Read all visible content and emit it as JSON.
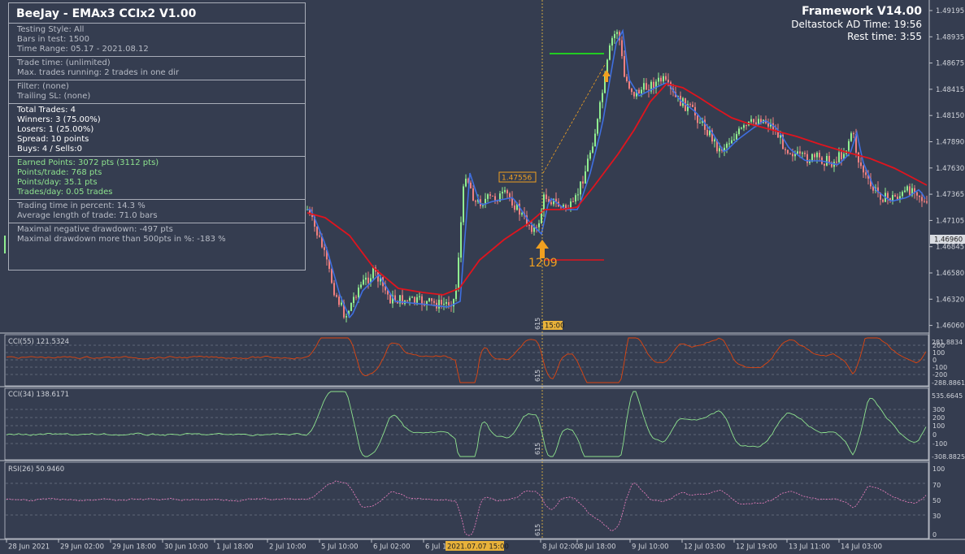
{
  "panel": {
    "title": "BeeJay - EMAx3 CCIx2 V1.00",
    "sections": [
      {
        "style": "gray",
        "lines": [
          "Testing Style:  All",
          "Bars in test: 1500",
          "Time Range: 05.17 - 2021.08.12"
        ]
      },
      {
        "style": "gray",
        "lines": [
          "Trade time: (unlimited)",
          "Max. trades running: 2 trades in one dir"
        ]
      },
      {
        "style": "gray",
        "lines": [
          "Filter: (none)",
          "Trailing SL: (none)"
        ]
      },
      {
        "style": "white",
        "lines": [
          "Total Trades: 4",
          "Winners: 3  (75.00%)",
          "Losers: 1  (25.00%)",
          "Spread: 10 points",
          "Buys: 4 / Sells:0"
        ]
      },
      {
        "style": "green",
        "lines": [
          "Earned Points: 3072 pts (3112 pts)",
          "Points/trade: 768 pts",
          "Points/day: 35.1 pts",
          "Trades/day: 0.05 trades"
        ]
      },
      {
        "style": "gray",
        "lines": [
          "Trading time in percent: 14.3 %",
          "Average length of trade: 71.0 bars"
        ]
      },
      {
        "style": "gray",
        "lines": [
          "Maximal negative drawdown: -497 pts",
          "Maximal drawdown more than 500pts in %: -183 %"
        ]
      }
    ]
  },
  "top_right": {
    "framework": "Framework V14.00",
    "time_line": "Deltastock AD Time: 19:56",
    "rest_line": "Rest time: 3:55"
  },
  "chart": {
    "price_ticks": [
      "1.49195",
      "1.48935",
      "1.48675",
      "1.48415",
      "1.48150",
      "1.47890",
      "1.47630",
      "1.47365",
      "1.47105",
      "1.46845",
      "1.46580",
      "1.46320",
      "1.46060"
    ],
    "current_price": "1.46960",
    "price_marker": "1.47556",
    "trade_label": "1209",
    "vline_label": "615",
    "vline_time": "15:00",
    "dates": [
      "28 Jun 2021",
      "29 Jun 02:00",
      "29 Jun 18:00",
      "30 Jun 10:00",
      "1 Jul 18:00",
      "2 Jul 10:00",
      "5 Jul 10:00",
      "6 Jul 02:00",
      "6 Jul 18:00",
      "2021.07.07 15:00",
      "8 Jul 02:00",
      "8 Jul 18:00",
      "9 Jul 10:00",
      "12 Jul 03:00",
      "12 Jul 19:00",
      "13 Jul 11:00",
      "14 Jul 03:00"
    ]
  },
  "indicators": {
    "cci55": {
      "label": "CCI(55) 121.5324",
      "max": "281.8834",
      "ticks": [
        "200",
        "100",
        "0",
        "-100",
        "-200"
      ],
      "min": "-288.8861"
    },
    "cci34": {
      "label": "CCI(34) 138.6171",
      "max": "535.6645",
      "ticks": [
        "300",
        "200",
        "100",
        "0",
        "-100"
      ],
      "min": "-308.8825"
    },
    "rsi": {
      "label": "RSI(26) 50.9460",
      "ticks": [
        "100",
        "70",
        "50",
        "30",
        "0"
      ]
    }
  },
  "colors": {
    "bg": "#353d50",
    "bull": "#90ee90",
    "bear": "#f08080",
    "ema_fast": "#3f6fe0",
    "ema_slow": "#e0141e",
    "cci55": "#e0450f",
    "cci34": "#8ee38e",
    "rsi": "#e07ab8",
    "marker": "#f0a020"
  }
}
